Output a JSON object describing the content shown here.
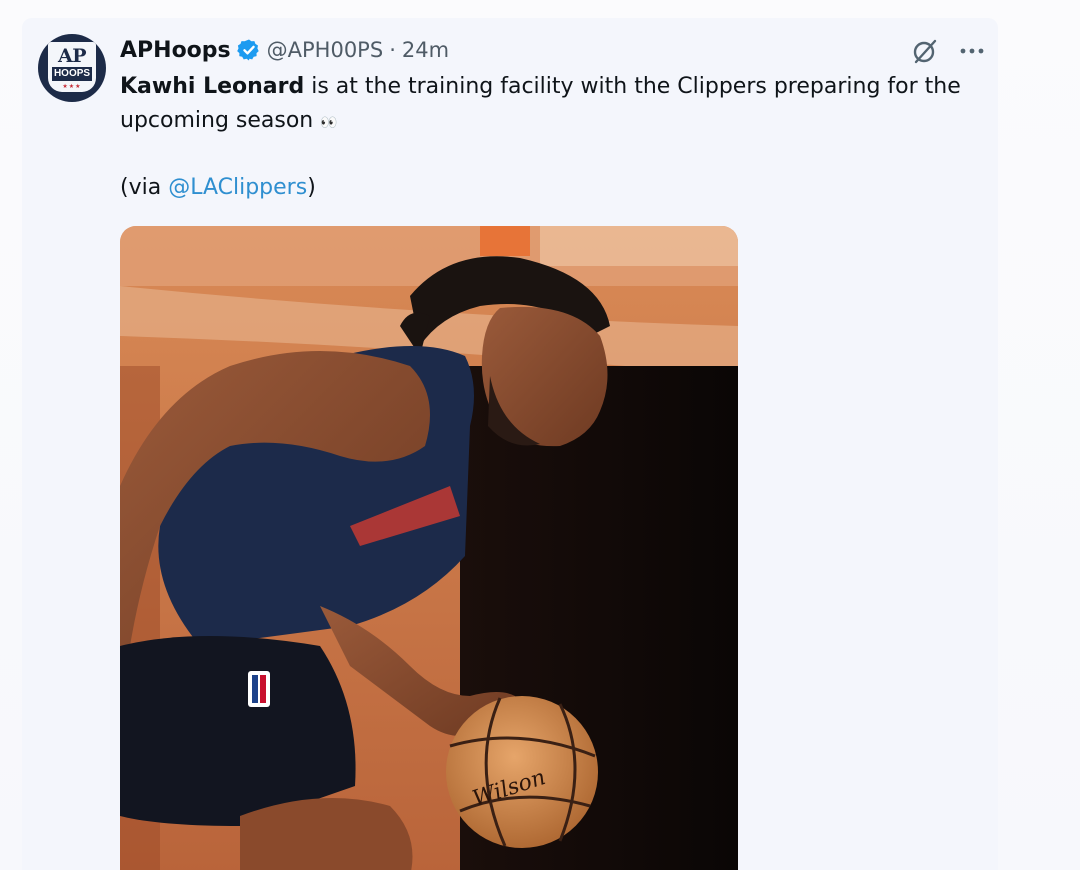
{
  "tweet": {
    "avatar": {
      "line1": "AP",
      "line2": "HOOPS",
      "dots": "★★★"
    },
    "display_name": "APHoops",
    "verified_icon": "verified-badge-icon",
    "handle": "@APH00PS",
    "separator": "·",
    "timestamp": "24m",
    "actions": {
      "grok_icon": "grok-icon",
      "more_icon": "more-options-icon"
    },
    "text": {
      "player_name": "Kawhi Leonard",
      "body_line": " is at the training facility with the Clippers preparing for the upcoming season ",
      "emoji": "👀",
      "via_open": "(via ",
      "via_mention": "@LAClippers",
      "via_close": ")"
    },
    "media": {
      "description_icon": "photo",
      "ball_brand": "Wilson"
    }
  },
  "colors": {
    "background": "#f4f6fc",
    "text": "#0f1419",
    "muted": "#4f5b66",
    "link": "#2f8fd0",
    "verified": "#1d9bf0"
  }
}
